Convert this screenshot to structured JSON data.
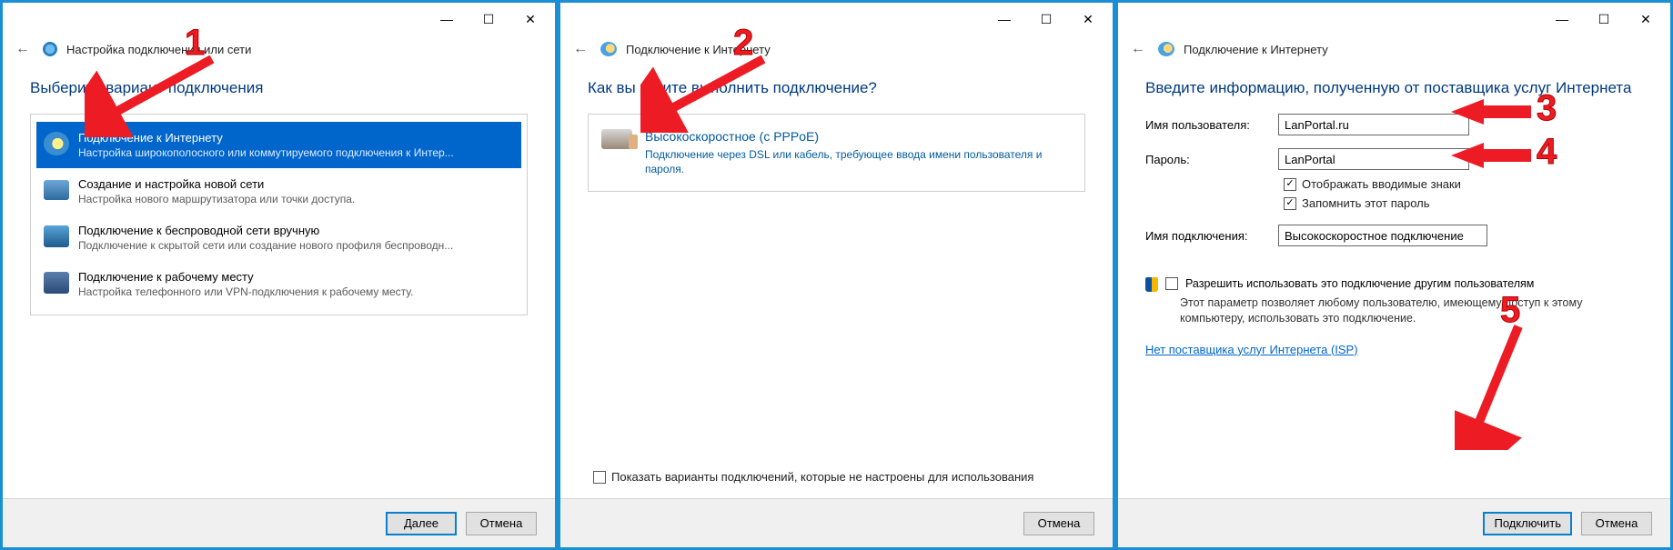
{
  "panels": {
    "p1": {
      "hdr_title": "Настройка подключения или сети",
      "headline": "Выберите вариант подключения",
      "options": [
        {
          "title": "Подключение к Интернету",
          "sub": "Настройка широкополосного или коммутируемого подключения к Интер..."
        },
        {
          "title": "Создание и настройка новой сети",
          "sub": "Настройка нового маршрутизатора или точки доступа."
        },
        {
          "title": "Подключение к беспроводной сети вручную",
          "sub": "Подключение к скрытой сети или создание нового профиля беспроводн..."
        },
        {
          "title": "Подключение к рабочему месту",
          "sub": "Настройка телефонного или VPN-подключения к рабочему месту."
        }
      ],
      "footer": {
        "next": "Далее",
        "cancel": "Отмена"
      }
    },
    "p2": {
      "hdr_title": "Подключение к Интернету",
      "headline": "Как вы хотите выполнить подключение?",
      "opt": {
        "title": "Высокоскоростное (с PPPoE)",
        "sub": "Подключение через DSL или кабель, требующее ввода имени пользователя и пароля."
      },
      "show_unconfigured": "Показать варианты подключений, которые не настроены для использования",
      "footer": {
        "cancel": "Отмена"
      }
    },
    "p3": {
      "hdr_title": "Подключение к Интернету",
      "headline": "Введите информацию, полученную от поставщика услуг Интернета",
      "labels": {
        "user": "Имя пользователя:",
        "pass": "Пароль:",
        "show_chars": "Отображать вводимые знаки",
        "remember": "Запомнить этот пароль",
        "conn_name": "Имя подключения:"
      },
      "values": {
        "user": "LanPortal.ru",
        "pass": "LanPortal",
        "conn_name": "Высокоскоростное подключение"
      },
      "perm": {
        "head": "Разрешить использовать это подключение другим пользователям",
        "desc": "Этот параметр позволяет любому пользователю, имеющему доступ к этому компьютеру, использовать это подключение."
      },
      "isp_link": "Нет поставщика услуг Интернета (ISP)",
      "footer": {
        "connect": "Подключить",
        "cancel": "Отмена"
      }
    }
  },
  "titlebar_glyphs": {
    "min": "—",
    "max": "☐",
    "close": "✕"
  },
  "annotations": {
    "n1": "1",
    "n2": "2",
    "n3": "3",
    "n4": "4",
    "n5": "5"
  }
}
